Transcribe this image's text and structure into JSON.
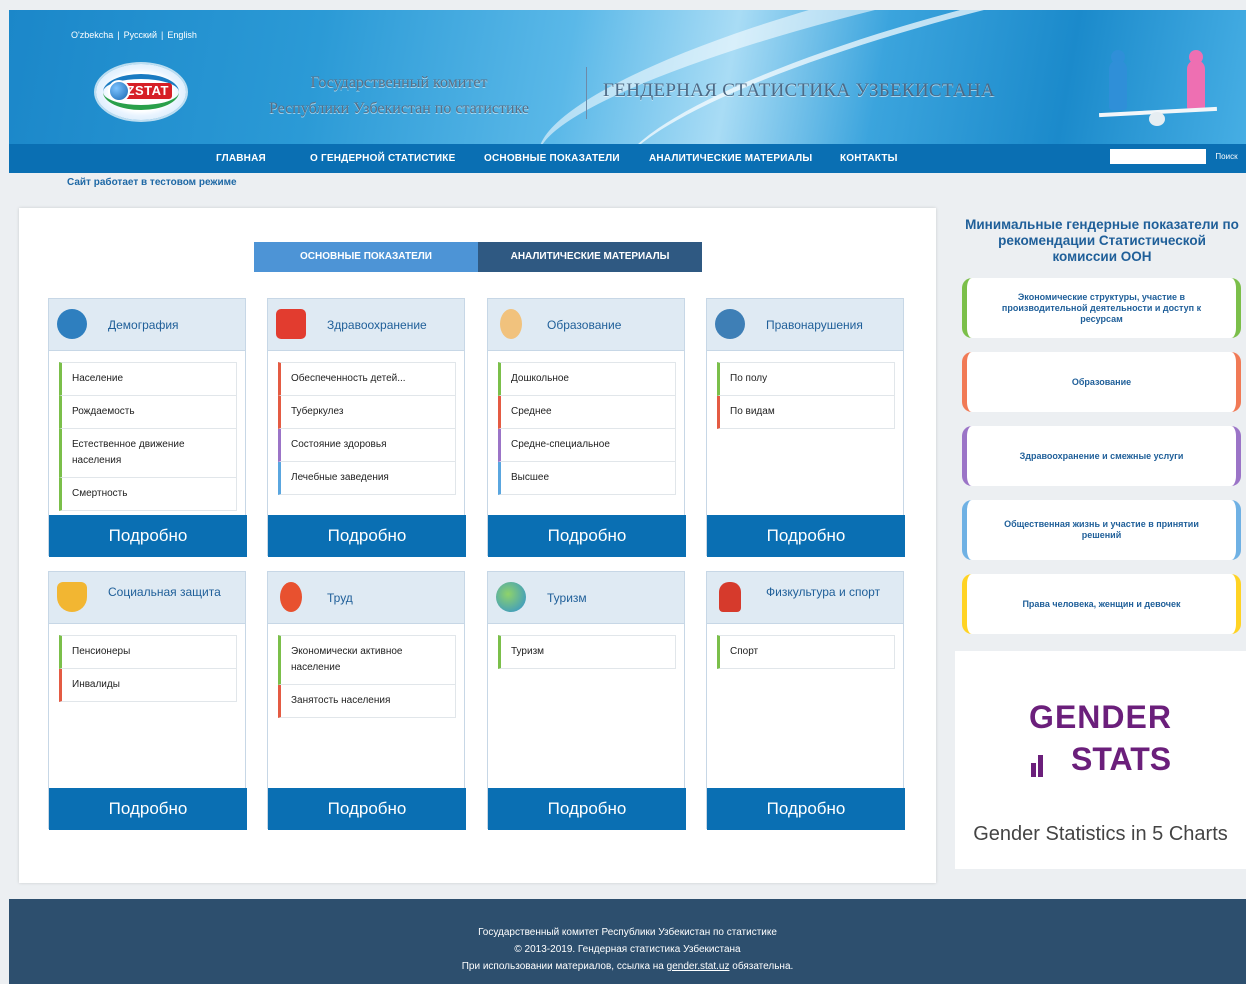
{
  "header": {
    "languages": [
      "O'zbekcha",
      "Русский",
      "English"
    ],
    "org_line1": "Государственный комитет",
    "org_line2": "Республики Узбекистан по статистике",
    "site_title": "ГЕНДЕРНАЯ СТАТИСТИКА УЗБЕКИСТАНА",
    "logo_text": "'ZSTAT"
  },
  "nav": {
    "items": [
      "ГЛАВНАЯ",
      "О ГЕНДЕРНОЙ СТАТИСТИКЕ",
      "ОСНОВНЫЕ ПОКАЗАТЕЛИ",
      "АНАЛИТИЧЕСКИЕ МАТЕРИАЛЫ",
      "КОНТАКТЫ"
    ],
    "search_button": "Поиск",
    "search_value": ""
  },
  "notice": "Сайт работает в тестовом режиме",
  "tabs": [
    "ОСНОВНЫЕ ПОКАЗАТЕЛИ",
    "АНАЛИТИЧЕСКИЕ МАТЕРИАЛЫ"
  ],
  "more_label": "Подробно",
  "cards": [
    {
      "title": "Демография",
      "icon": "demography-icon",
      "items": [
        "Население",
        "Рождаемость",
        "Естественное движение населения",
        "Смертность"
      ]
    },
    {
      "title": "Здравоохранение",
      "icon": "first-aid-kit-icon",
      "items": [
        "Обеспеченность детей...",
        "Туберкулез",
        "Состояние здоровья",
        "Лечебные заведения"
      ]
    },
    {
      "title": "Образование",
      "icon": "graduate-icon",
      "items": [
        "Дошкольное",
        "Среднее",
        "Средне-специальное",
        "Высшее"
      ]
    },
    {
      "title": "Правонарушения",
      "icon": "law-icon",
      "items": [
        "По полу",
        "По видам"
      ]
    },
    {
      "title": "Социальная защита",
      "icon": "shield-icon",
      "items": [
        "Пенсионеры",
        "Инвалиды"
      ]
    },
    {
      "title": "Труд",
      "icon": "worker-icon",
      "items": [
        "Экономически активное население",
        "Занятость населения"
      ]
    },
    {
      "title": "Туризм",
      "icon": "globe-icon",
      "items": [
        "Туризм"
      ]
    },
    {
      "title": "Физкультура и спорт",
      "icon": "boxing-glove-icon",
      "items": [
        "Спорт"
      ]
    }
  ],
  "sidebar": {
    "title": "Минимальные гендерные показатели по рекомендации Статистической комиссии ООН",
    "items": [
      "Экономические структуры, участие в производительной деятельности и доступ к ресурсам",
      "Образование",
      "Здравоохранение и смежные услуги",
      "Общественная жизнь и участие в принятии решений",
      "Права человека, женщин и девочек"
    ],
    "banner_line1": "GENDER",
    "banner_line2": "STATS",
    "banner_caption": "Gender Statistics in 5 Charts"
  },
  "footer": {
    "line1": "Государственный комитет Республики Узбекистан по статистике",
    "line2": "© 2013-2019. Гендерная статистика Узбекистана",
    "line3_pre": "При использовании материалов, ссылка на",
    "line3_link": "gender.stat.uz",
    "line3_post": "обязательна."
  },
  "colors": {
    "nav": "#0a6fb3",
    "footer": "#2d4f6e",
    "accent_title": "#1f5f99",
    "gender_stats": "#6b1f7b"
  }
}
